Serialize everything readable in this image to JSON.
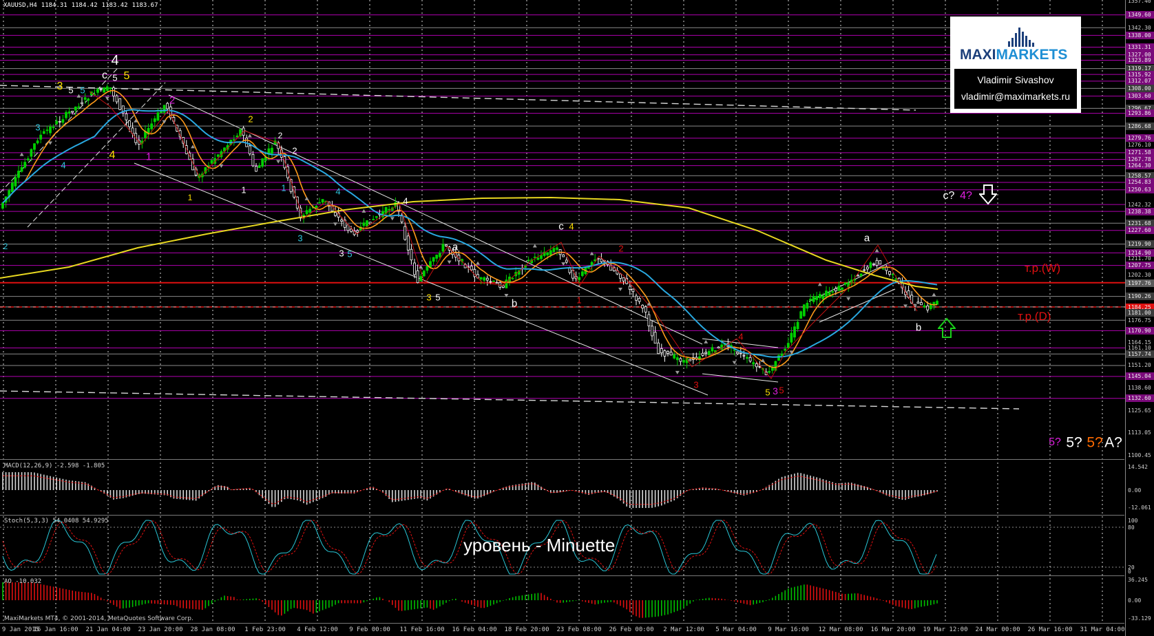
{
  "header": {
    "symbol": "XAUUSD,H4",
    "open": "1184.31",
    "high": "1184.42",
    "low": "1183.42",
    "close": "1183.67"
  },
  "logo": {
    "brand_a": "MAXI",
    "brand_b": "MARKETS",
    "author": "Vladimir Sivashov",
    "email": "vladimir@maximarkets.ru"
  },
  "level_labels": {
    "w": "т.р.(W)",
    "d": "т.р.(D)"
  },
  "minuette_label": "уровень - Minuette",
  "indicators": {
    "macd": "MACD(12,26,9) -2.598 -1.805",
    "stoch": "Stoch(5,3,3) 54.0408 54.9295",
    "ao": "AO -10.032"
  },
  "copyright": "MaxiMarkets MT4, © 2001-2014, MetaQuotes Software Corp.",
  "price_axis": [
    "1357.40",
    "1349.60",
    "1342.30",
    "1338.00",
    "1331.31",
    "1327.00",
    "1323.89",
    "1319.17",
    "1315.92",
    "1312.07",
    "1308.00",
    "1303.60",
    "1296.67",
    "1293.86",
    "1286.68",
    "1279.76",
    "1276.10",
    "1271.58",
    "1267.78",
    "1264.30",
    "1258.57",
    "1254.83",
    "1250.63",
    "1242.32",
    "1238.38",
    "1231.68",
    "1227.60",
    "1219.90",
    "1214.90",
    "1211.70",
    "1207.75",
    "1202.30",
    "1197.76",
    "1190.26",
    "1184.25",
    "1181.00",
    "1176.75",
    "1170.90",
    "1164.15",
    "1161.10",
    "1157.74",
    "1151.20",
    "1145.04",
    "1138.60",
    "1132.60",
    "1125.65",
    "1113.05",
    "1100.45"
  ],
  "indicator_axis": {
    "macd": [
      "14.542",
      "0.00",
      "-12.061"
    ],
    "stoch": [
      "100",
      "80",
      "20",
      "0"
    ],
    "ao": [
      "36.245",
      "0.00",
      "-33.129"
    ]
  },
  "time_axis": [
    "9 Jan 2015",
    "16 Jan 16:00",
    "21 Jan 04:00",
    "23 Jan 20:00",
    "28 Jan 08:00",
    "1 Feb 23:00",
    "4 Feb 12:00",
    "9 Feb 00:00",
    "11 Feb 16:00",
    "16 Feb 04:00",
    "18 Feb 20:00",
    "23 Feb 08:00",
    "26 Feb 00:00",
    "2 Mar 12:00",
    "5 Mar 04:00",
    "9 Mar 16:00",
    "12 Mar 08:00",
    "16 Mar 20:00",
    "19 Mar 12:00",
    "24 Mar 00:00",
    "26 Mar 16:00",
    "31 Mar 04:00"
  ],
  "wave_labels": [
    {
      "t": "4",
      "c": "#ffffff"
    },
    {
      "t": "c",
      "c": "#ffffff"
    },
    {
      "t": "5",
      "c": "#ffffff"
    },
    {
      "t": "5",
      "c": "#ffe000"
    },
    {
      "t": "3",
      "c": "#ffe000"
    },
    {
      "t": "5",
      "c": "#ffffff"
    },
    {
      "t": "5",
      "c": "#2ec8e0"
    },
    {
      "t": "3",
      "c": "#2ec8e0"
    },
    {
      "t": "4",
      "c": "#2ec8e0"
    },
    {
      "t": "4",
      "c": "#ffe000"
    },
    {
      "t": "1",
      "c": "#e020e0"
    },
    {
      "t": "2",
      "c": "#e020e0"
    },
    {
      "t": "1",
      "c": "#ffe000"
    },
    {
      "t": "2",
      "c": "#ffe000"
    },
    {
      "t": "2",
      "c": "#ffffff"
    },
    {
      "t": "1",
      "c": "#ffffff"
    },
    {
      "t": "2",
      "c": "#ffffff"
    },
    {
      "t": "1",
      "c": "#2ec8e0"
    },
    {
      "t": "4",
      "c": "#2ec8e0"
    },
    {
      "t": "3",
      "c": "#2ec8e0"
    },
    {
      "t": "4",
      "c": "#ffffff"
    },
    {
      "t": "3",
      "c": "#ffffff"
    },
    {
      "t": "5",
      "c": "#2ec8e0"
    },
    {
      "t": "a",
      "c": "#ffffff"
    },
    {
      "t": "3",
      "c": "#ffe000"
    },
    {
      "t": "5",
      "c": "#ffffff"
    },
    {
      "t": "b",
      "c": "#ffffff"
    },
    {
      "t": "c",
      "c": "#ffffff"
    },
    {
      "t": "4",
      "c": "#ffe000"
    },
    {
      "t": "2",
      "c": "#e01010"
    },
    {
      "t": "1",
      "c": "#e01010"
    },
    {
      "t": "4",
      "c": "#e01010"
    },
    {
      "t": "3",
      "c": "#e01010"
    },
    {
      "t": "5",
      "c": "#e01010"
    },
    {
      "t": "5",
      "c": "#ffe000"
    },
    {
      "t": "3",
      "c": "#e020e0"
    },
    {
      "t": "a",
      "c": "#ffffff"
    },
    {
      "t": "b",
      "c": "#ffffff"
    },
    {
      "t": "2",
      "c": "#2ec8e0"
    }
  ],
  "forecast_top": [
    {
      "t": "c?",
      "c": "#ffffff"
    },
    {
      "t": "4?",
      "c": "#e020e0"
    }
  ],
  "forecast_bottom": [
    {
      "t": "5?",
      "c": "#e020e0"
    },
    {
      "t": "5?",
      "c": "#ffffff"
    },
    {
      "t": "5?",
      "c": "#ff6a00"
    },
    {
      "t": "A?",
      "c": "#ffffff"
    }
  ],
  "colors": {
    "background": "#000000",
    "bull": "#00d000",
    "bear": "#ffffff",
    "ma_fast": "#ff9a1a",
    "ma_mid": "#29a8e0",
    "ma_slow": "#e8d820",
    "level_line": "#e01010",
    "hline": "#b000b0",
    "channel": "#e8e8e8",
    "macd_hist": "#d8d8d8",
    "macd_signal": "#e01010",
    "stoch_main": "#29c8d8",
    "stoch_signal": "#e01010",
    "ao_up": "#00c000",
    "ao_down": "#e01010"
  }
}
